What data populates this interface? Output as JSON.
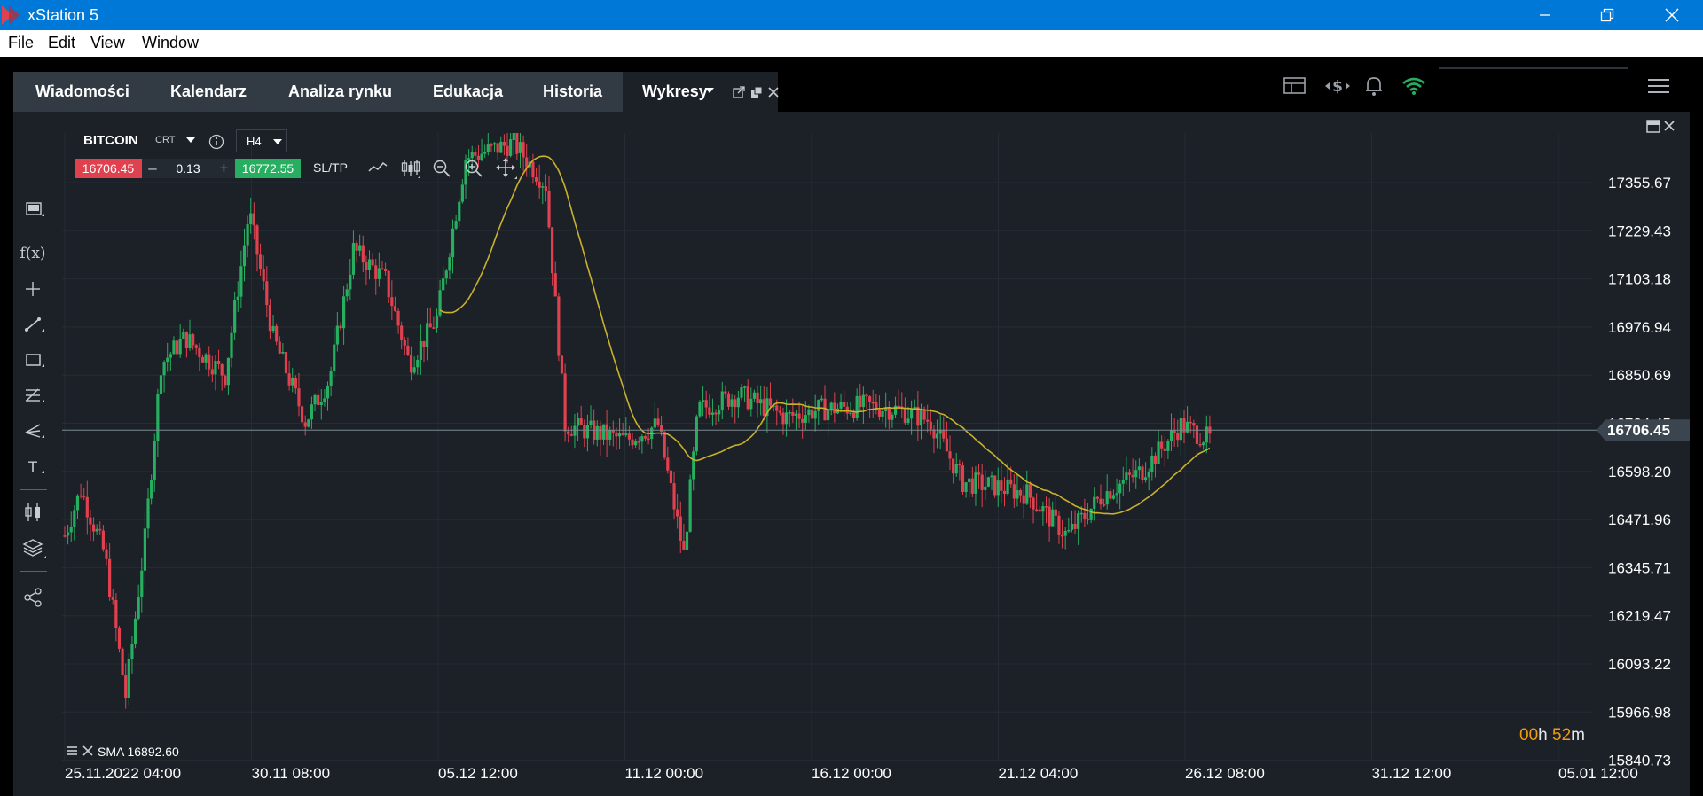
{
  "window": {
    "title": "xStation 5"
  },
  "menu": {
    "file": "File",
    "edit": "Edit",
    "view": "View",
    "window": "Window"
  },
  "tabs": [
    {
      "label": "Wiadomości"
    },
    {
      "label": "Kalendarz"
    },
    {
      "label": "Analiza rynku"
    },
    {
      "label": "Edukacja"
    },
    {
      "label": "Historia"
    },
    {
      "label": "Wykresy",
      "active": true
    }
  ],
  "instrument": {
    "symbol": "BITCOIN",
    "type": "CRT",
    "timeframe": "H4",
    "bid": "16706.45",
    "volume": "0.13",
    "ask": "16772.55",
    "sltp": "SL/TP"
  },
  "indicator": {
    "label": "SMA 16892.60"
  },
  "countdown": {
    "hours": "00",
    "h": "h",
    "minutes": "52",
    "m": "m"
  },
  "colors": {
    "up": "#27ae60",
    "down": "#e0414f",
    "sma": "#c9b12c",
    "background": "#1b2127",
    "bid": "#e0414f",
    "ask": "#27ae60",
    "accent": "#0078d7",
    "countdown": "#f39c12"
  },
  "chart_data": {
    "type": "candlestick",
    "symbol": "BITCOIN",
    "timeframe": "H4",
    "y_ticks": [
      "17355.67",
      "17229.43",
      "17103.18",
      "16976.94",
      "16850.69",
      "16724.45",
      "16598.20",
      "16471.96",
      "16345.71",
      "16219.47",
      "16093.22",
      "15966.98",
      "15840.73"
    ],
    "x_ticks": [
      "25.11.2022 04:00",
      "30.11 08:00",
      "05.12 12:00",
      "11.12 00:00",
      "16.12 00:00",
      "21.12 04:00",
      "26.12 08:00",
      "31.12 12:00",
      "05.01 12:00"
    ],
    "ylim": [
      15810,
      17480
    ],
    "current_price": "16706.45",
    "grid": true
  }
}
